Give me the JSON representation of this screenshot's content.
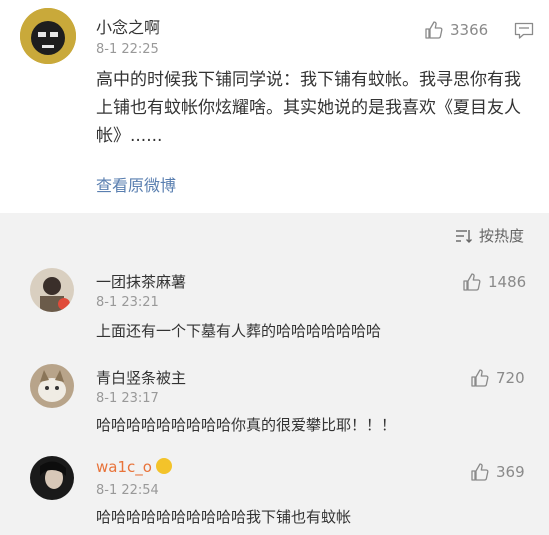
{
  "main_post": {
    "username": "小念之啊",
    "timestamp": "8-1 22:25",
    "likes": "3366",
    "text": "高中的时候我下铺同学说：我下铺有蚊帐。我寻思你有我上铺也有蚊帐你炫耀啥。其实她说的是我喜欢《夏目友人帐》......",
    "view_original": "查看原微博"
  },
  "sort": {
    "label": "按热度"
  },
  "replies": [
    {
      "username": "一团抹茶麻薯",
      "timestamp": "8-1 23:21",
      "likes": "1486",
      "text": "上面还有一个下墓有人葬的哈哈哈哈哈哈哈"
    },
    {
      "username": "青白竖条被主",
      "timestamp": "8-1 23:17",
      "likes": "720",
      "text": "哈哈哈哈哈哈哈哈哈你真的很爱攀比耶！！！"
    },
    {
      "username": "wa1c_o",
      "timestamp": "8-1 22:54",
      "likes": "369",
      "text": "哈哈哈哈哈哈哈哈哈哈我下铺也有蚊帐"
    }
  ],
  "colors": {
    "link": "#5a7fb0",
    "meta": "#999999",
    "background": "#f2f2f2"
  }
}
